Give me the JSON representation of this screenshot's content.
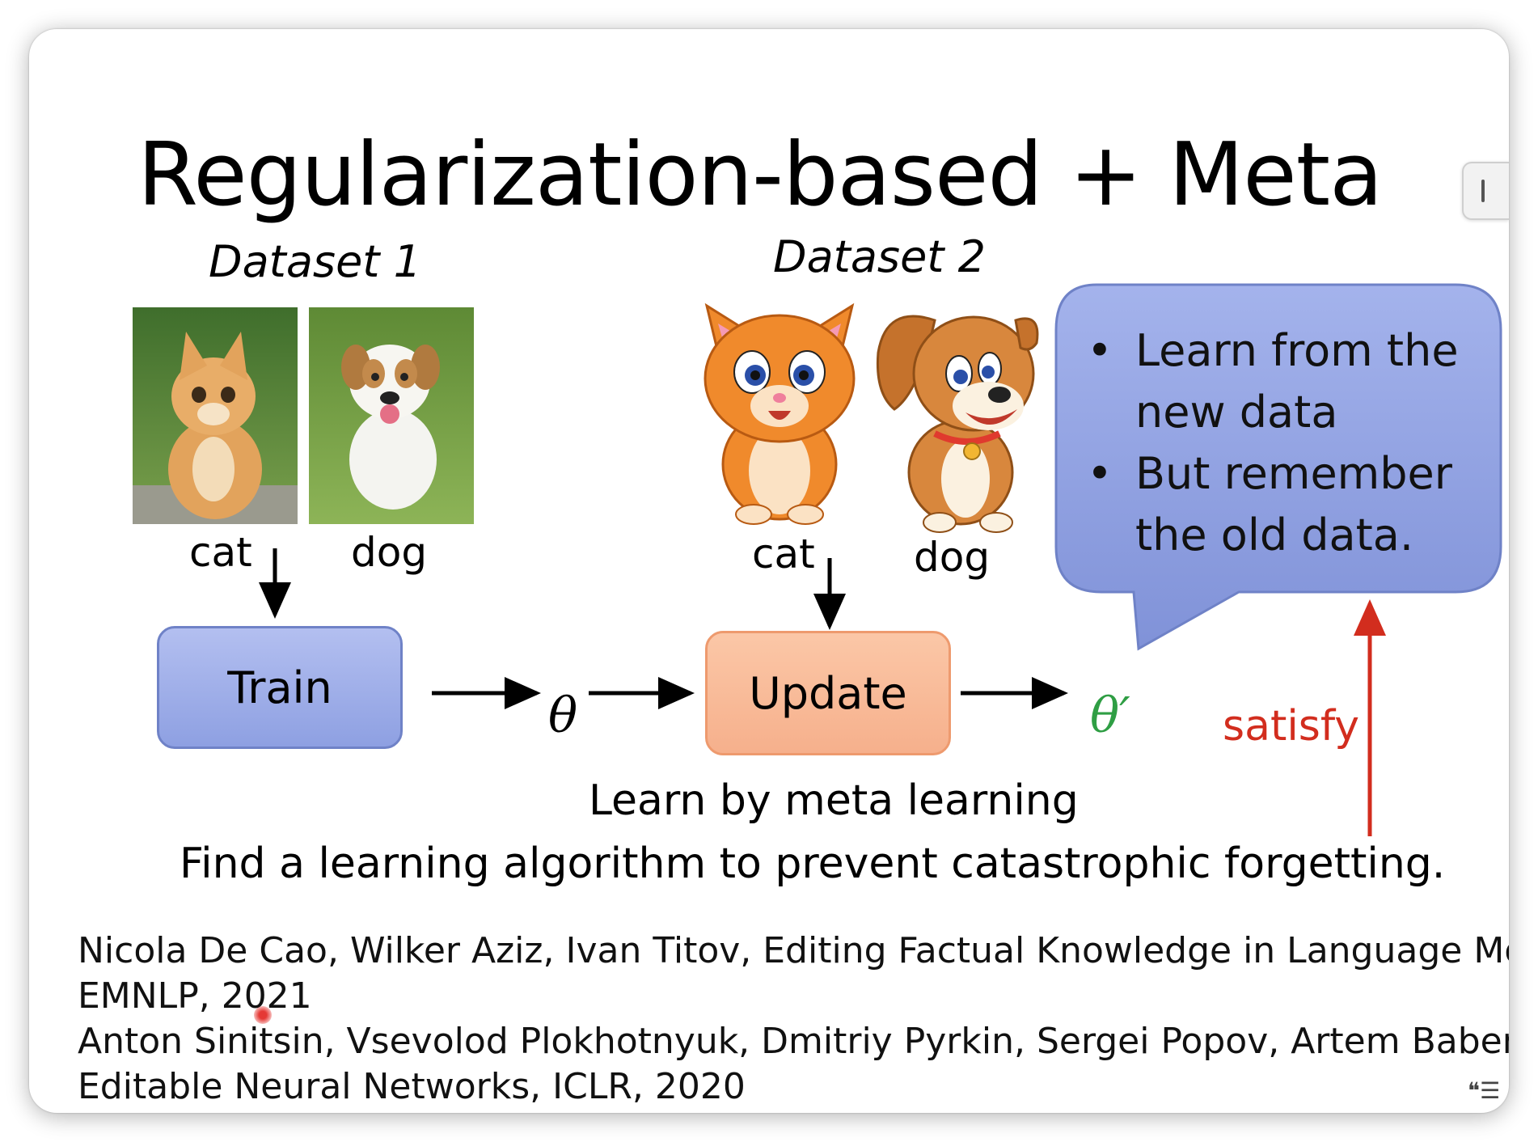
{
  "slide": {
    "title": "Regularization-based + Meta",
    "dataset1": {
      "label": "Dataset 1",
      "items": [
        "cat",
        "dog"
      ]
    },
    "dataset2": {
      "label": "Dataset 2",
      "items": [
        "cat",
        "dog"
      ]
    },
    "train_label": "Train",
    "update_label": "Update",
    "theta": "θ",
    "theta_prime": "θ′",
    "callout": {
      "bullet1": "Learn from the new data",
      "bullet2": "But remember the old data."
    },
    "satisfy_label": "satisfy",
    "note_line1": "Learn by meta learning",
    "note_line2": "Find a learning algorithm to prevent catastrophic forgetting.",
    "references": [
      "Nicola De Cao, Wilker Aziz, Ivan Titov, Editing Factual Knowledge in Language Models,",
      "EMNLP, 2021",
      "Anton Sinitsin, Vsevolod Plokhotnyuk, Dmitriy Pyrkin, Sergei Popov, Artem Babenko,",
      "Editable Neural Networks, ICLR, 2020"
    ]
  },
  "colors": {
    "train_fill": "#9dace8",
    "update_fill": "#f8b994",
    "callout_fill": "#8d9fdd",
    "theta_prime": "#2f9e44",
    "satisfy": "#d22d1e"
  },
  "icons": [
    "scroll-handle-icon",
    "closed-captions-icon",
    "laser-pointer-icon"
  ]
}
